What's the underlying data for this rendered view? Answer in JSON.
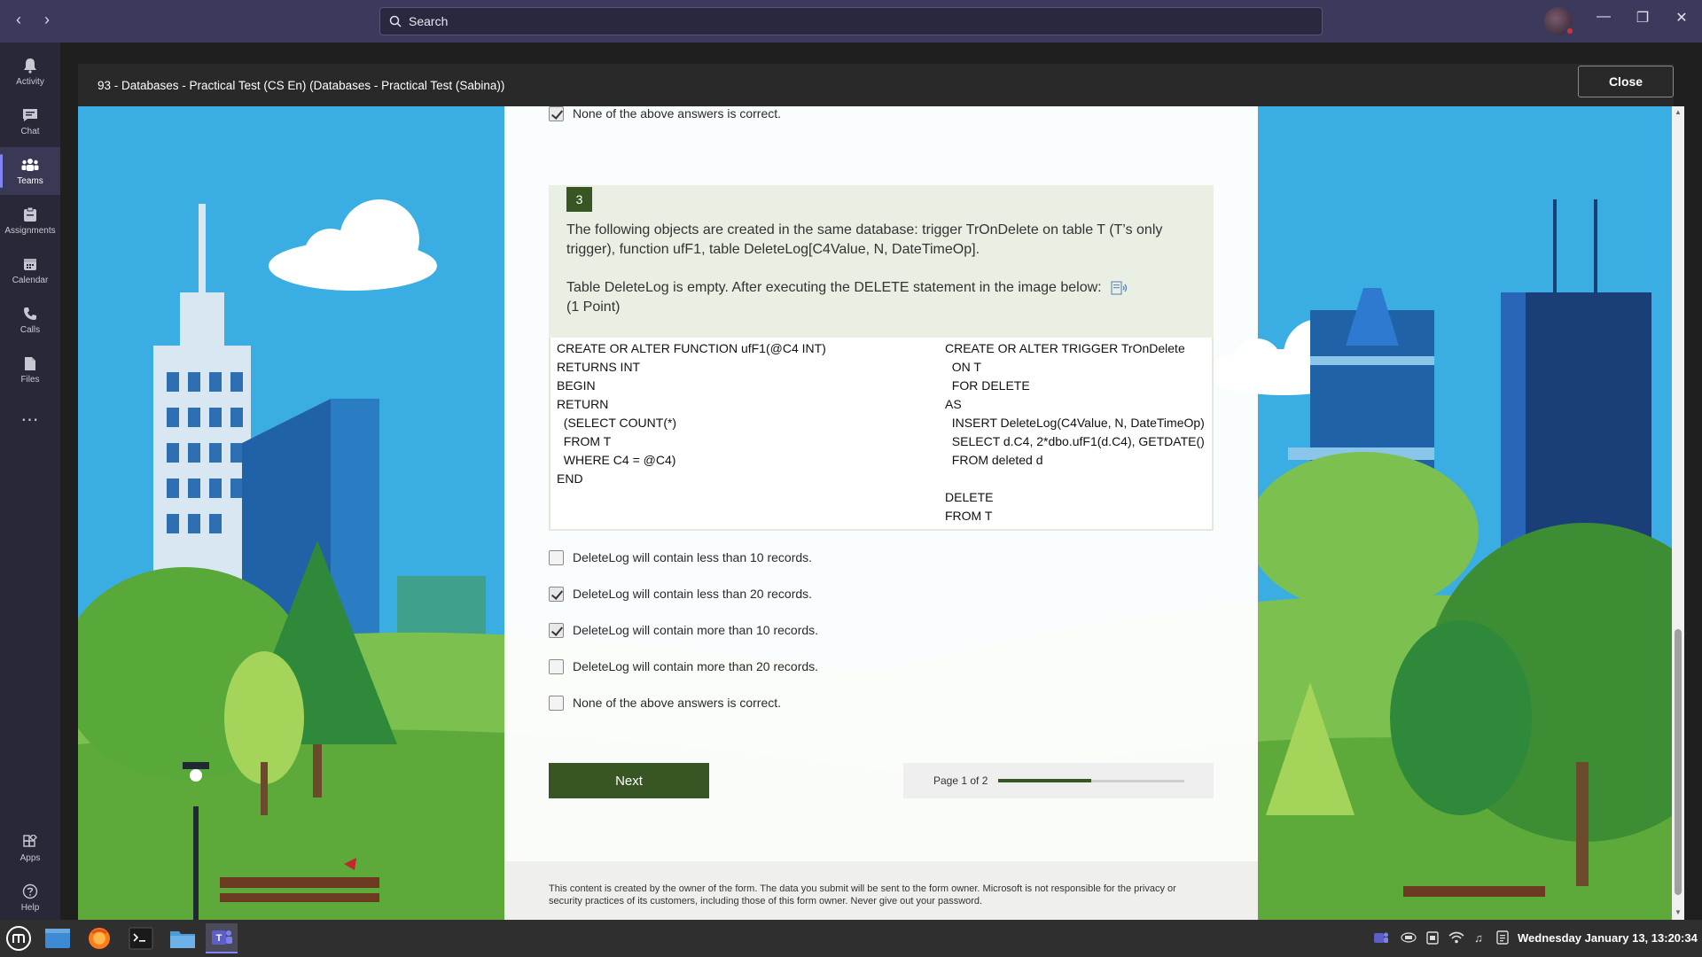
{
  "titlebar": {
    "search_placeholder": "Search"
  },
  "rail": {
    "items": [
      {
        "label": "Activity",
        "icon": "bell-icon"
      },
      {
        "label": "Chat",
        "icon": "chat-icon"
      },
      {
        "label": "Teams",
        "icon": "teams-icon"
      },
      {
        "label": "Assignments",
        "icon": "assignments-icon"
      },
      {
        "label": "Calendar",
        "icon": "calendar-icon"
      },
      {
        "label": "Calls",
        "icon": "phone-icon"
      },
      {
        "label": "Files",
        "icon": "files-icon"
      }
    ],
    "bottom": [
      {
        "label": "Apps",
        "icon": "apps-icon"
      },
      {
        "label": "Help",
        "icon": "help-icon"
      }
    ],
    "active": "Teams"
  },
  "dialog": {
    "title": "93 - Databases - Practical Test (CS En) (Databases - Practical Test (Sabina))",
    "close_label": "Close"
  },
  "form": {
    "prev_option": {
      "label": "None of the above answers is correct.",
      "checked": true
    },
    "question": {
      "number": "3",
      "text1": "The following objects are created in the same database: trigger TrOnDelete on table T (T’s only trigger), function ufF1, table DeleteLog[C4Value, N, DateTimeOp].",
      "text2": "Table DeleteLog is empty. After executing the DELETE statement in the image below:",
      "points": "(1 Point)"
    },
    "code_left": [
      "CREATE OR ALTER FUNCTION ufF1(@C4 INT)",
      "RETURNS INT",
      "BEGIN",
      "RETURN",
      "  (SELECT COUNT(*)",
      "  FROM T",
      "  WHERE C4 = @C4)",
      "END"
    ],
    "code_right": [
      "CREATE OR ALTER TRIGGER TrOnDelete",
      "  ON T",
      "  FOR DELETE",
      "AS",
      "  INSERT DeleteLog(C4Value, N, DateTimeOp)",
      "  SELECT d.C4, 2*dbo.ufF1(d.C4), GETDATE()",
      "  FROM deleted d",
      "",
      "DELETE",
      "FROM T"
    ],
    "options": [
      {
        "label": "DeleteLog will contain less than 10 records.",
        "checked": false
      },
      {
        "label": "DeleteLog will contain less than 20 records.",
        "checked": true
      },
      {
        "label": "DeleteLog will contain more than 10 records.",
        "checked": true
      },
      {
        "label": "DeleteLog will contain more than 20 records.",
        "checked": false
      },
      {
        "label": "None of the above answers is correct.",
        "checked": false
      }
    ],
    "next_label": "Next",
    "pager_text": "Page 1 of 2",
    "progress": 0.5,
    "footer": "This content is created by the owner of the form. The data you submit will be sent to the form owner. Microsoft is not responsible for the privacy or security practices of its customers, including those of this form owner. Never give out your password."
  },
  "taskbar": {
    "clock": "Wednesday January 13, 13:20:34"
  },
  "colors": {
    "accent_green": "#385623",
    "teams_purple": "#3b3a5c",
    "sky": "#3aaee3"
  }
}
